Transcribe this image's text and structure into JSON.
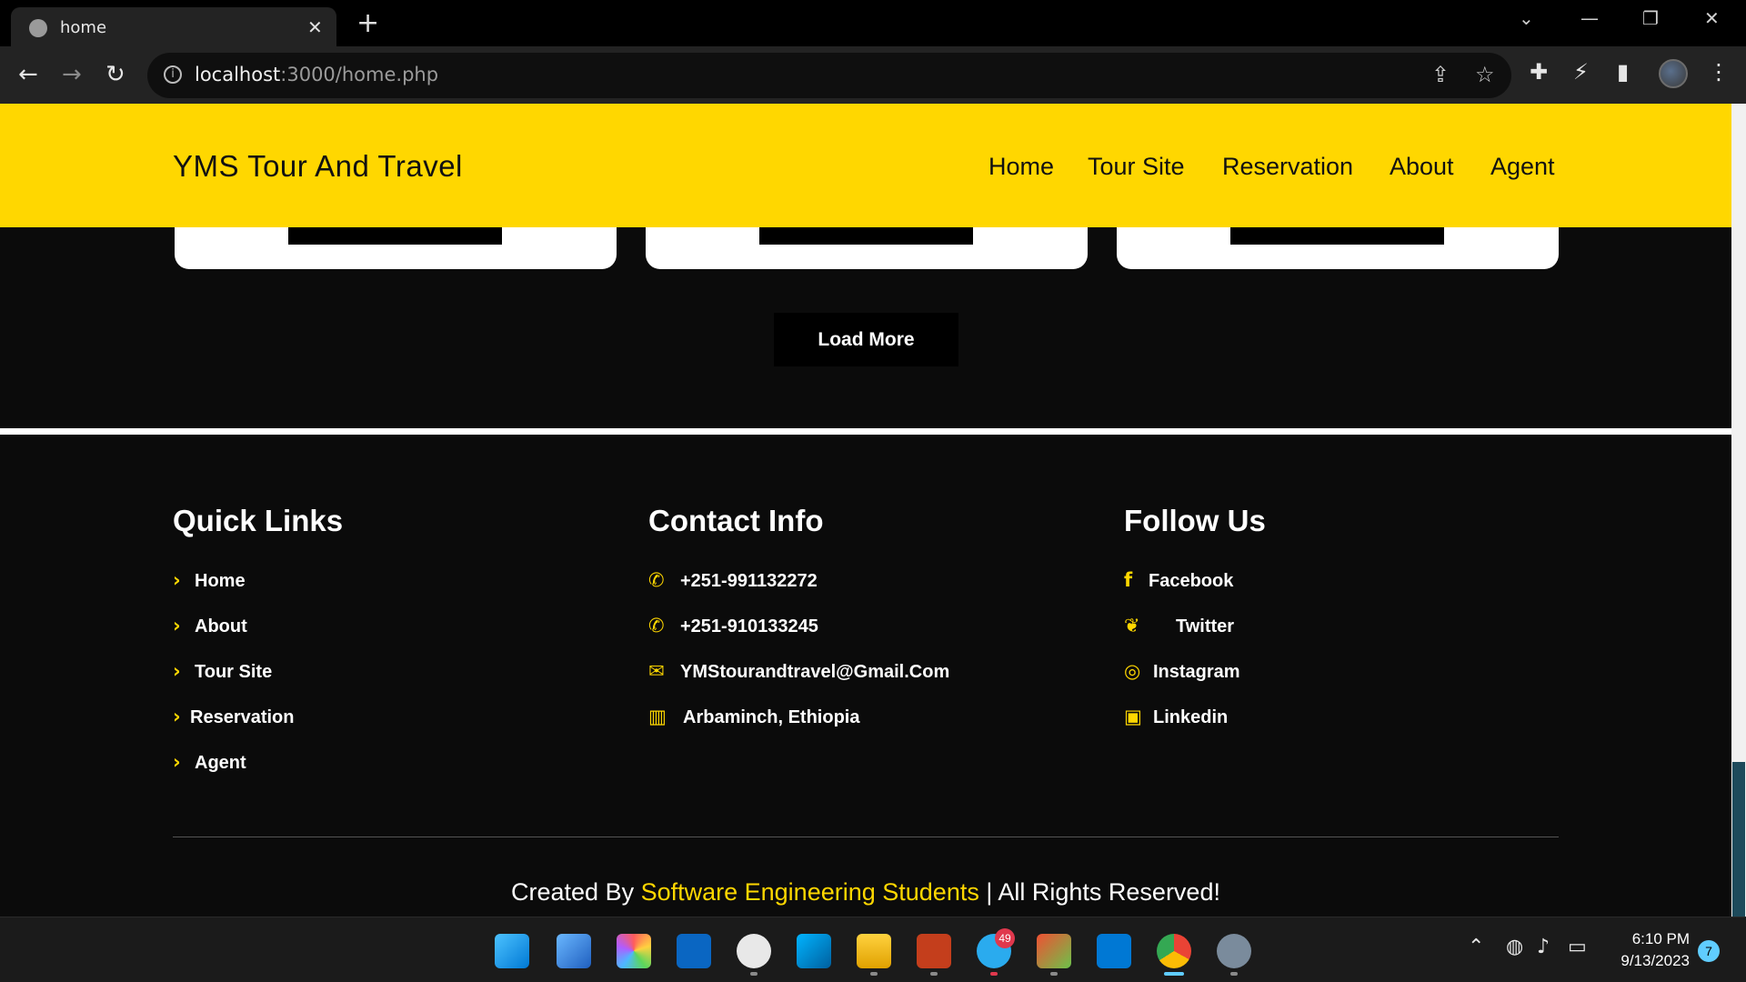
{
  "browser": {
    "tab_title": "home",
    "url_host": "localhost",
    "url_path": ":3000/home.php"
  },
  "site": {
    "logo": "YMS Tour And Travel",
    "nav": [
      "Home",
      "Tour Site",
      "Reservation",
      "About",
      "Agent"
    ],
    "load_more": "Load More"
  },
  "footer": {
    "quick_links": {
      "heading": "Quick Links",
      "items": [
        "Home",
        "About",
        "Tour Site",
        "Reservation",
        "Agent"
      ]
    },
    "contact": {
      "heading": "Contact Info",
      "items": [
        "+251-991132272",
        "+251-910133245",
        "YMStourandtravel@Gmail.Com",
        "Arbaminch, Ethiopia"
      ]
    },
    "follow": {
      "heading": "Follow Us",
      "items": [
        "Facebook",
        "Twitter",
        "Instagram",
        "Linkedin"
      ]
    },
    "credit_prefix": "Created By ",
    "credit_highlight": "Software Engineering Students",
    "credit_suffix": " | All Rights Reserved!"
  },
  "taskbar": {
    "telegram_badge": "49",
    "time": "6:10 PM",
    "date": "9/13/2023",
    "notifications": "7"
  },
  "colors": {
    "accent": "#ffd700",
    "page_bg": "#0b0b0b"
  }
}
